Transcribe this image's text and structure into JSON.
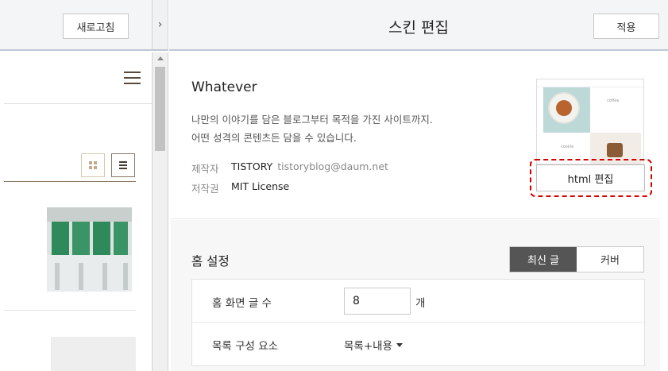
{
  "preview": {
    "refresh_label": "새로고침",
    "toggle_icon": "›"
  },
  "editor": {
    "title": "스킨 편집",
    "apply_label": "적용"
  },
  "skin": {
    "name": "Whatever",
    "description_line1": "나만의 이야기를 담은 블로그부터 목적을 가진 사이트까지.",
    "description_line2": "어떤 성격의 콘텐츠든 담을 수 있습니다.",
    "author_label": "제작자",
    "author_name": "TISTORY",
    "author_email": "tistoryblog@daum.net",
    "license_label": "저작권",
    "license_value": "MIT License",
    "thumb_text_coffee": "coffee",
    "thumb_text_cookie": "cookie",
    "html_edit_label": "html 편집"
  },
  "home_settings": {
    "title": "홈 설정",
    "tabs": [
      {
        "label": "최신 글",
        "active": true
      },
      {
        "label": "커버",
        "active": false
      }
    ],
    "post_count_label": "홈 화면 글 수",
    "post_count_value": "8",
    "post_count_unit": "개",
    "list_layout_label": "목록 구성 요소",
    "list_layout_value": "목록+내용"
  },
  "colors": {
    "highlight_dashed": "#d40000",
    "active_tab": "#555555",
    "header_bg": "#f4f5f7"
  }
}
